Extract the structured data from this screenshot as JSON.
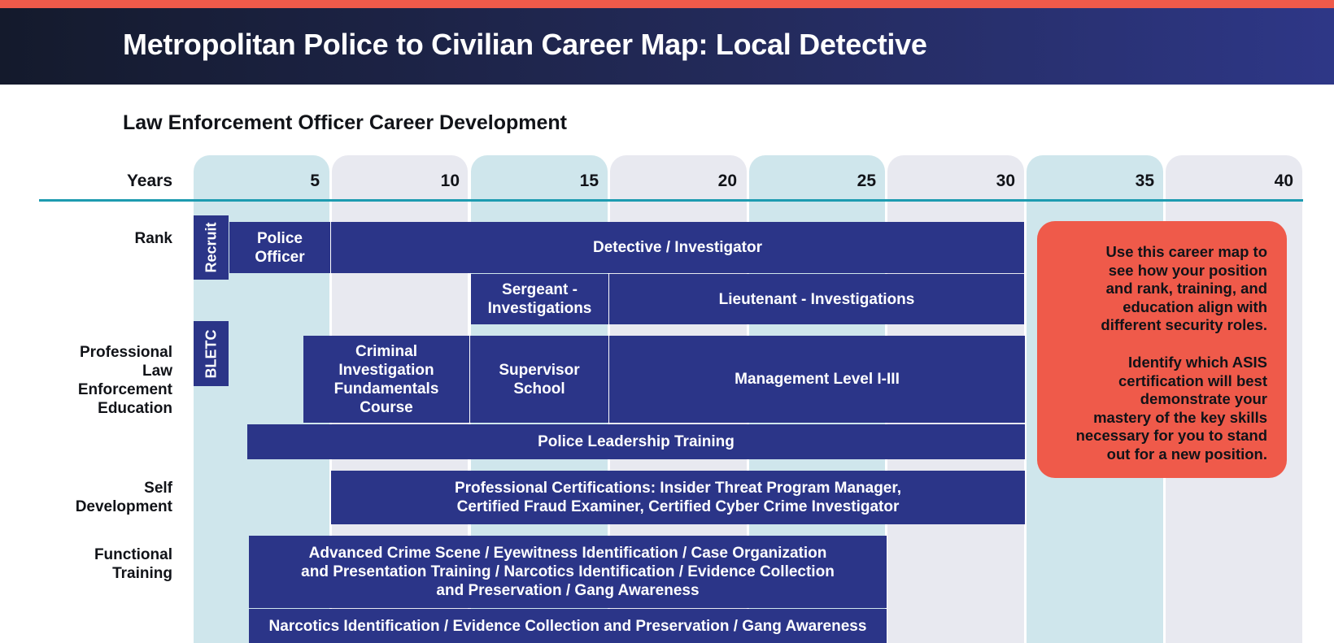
{
  "title": "Metropolitan Police to Civilian Career Map: Local Detective",
  "subtitle": "Law Enforcement Officer Career Development",
  "axis": {
    "label": "Years",
    "ticks": [
      "5",
      "10",
      "15",
      "20",
      "25",
      "30",
      "35",
      "40"
    ]
  },
  "row_labels": {
    "rank": "Rank",
    "education": "Professional\nLaw\nEnforcement\nEducation",
    "self_development": "Self\nDevelopment",
    "functional": "Functional\nTraining"
  },
  "bars": {
    "recruit": "Recruit",
    "bletc": "BLETC",
    "police_officer": "Police\nOfficer",
    "detective": "Detective / Investigator",
    "sergeant": "Sergeant -\nInvestigations",
    "lieutenant": "Lieutenant - Investigations",
    "criminal_investigation": "Criminal\nInvestigation\nFundamentals\nCourse",
    "supervisor_school": "Supervisor\nSchool",
    "management": "Management Level I-III",
    "leadership": "Police Leadership Training",
    "certifications": "Professional Certifications: Insider Threat Program Manager,\nCertified Fraud Examiner, Certified Cyber Crime Investigator",
    "advanced_crime": "Advanced Crime Scene / Eyewitness Identification  / Case Organization\nand Presentation Training / Narcotics Identification / Evidence Collection\nand Preservation / Gang Awareness",
    "narcotics": "Narcotics Identification / Evidence Collection and Preservation / Gang Awareness"
  },
  "note": {
    "paragraph1": "Use this career map to\nsee how your position\nand rank, training, and\neducation align with\ndifferent security roles.",
    "paragraph2": "Identify which ASIS\ncertification will best\ndemonstrate your\nmastery of the key skills\nnecessary for you to stand\nout for a new position."
  },
  "colors": {
    "bar": "#2b3588",
    "accent": "#ef5a4a",
    "column_teal": "#cfe6ec",
    "column_gray": "#e8e9f0",
    "axis": "#1d9bb0"
  }
}
